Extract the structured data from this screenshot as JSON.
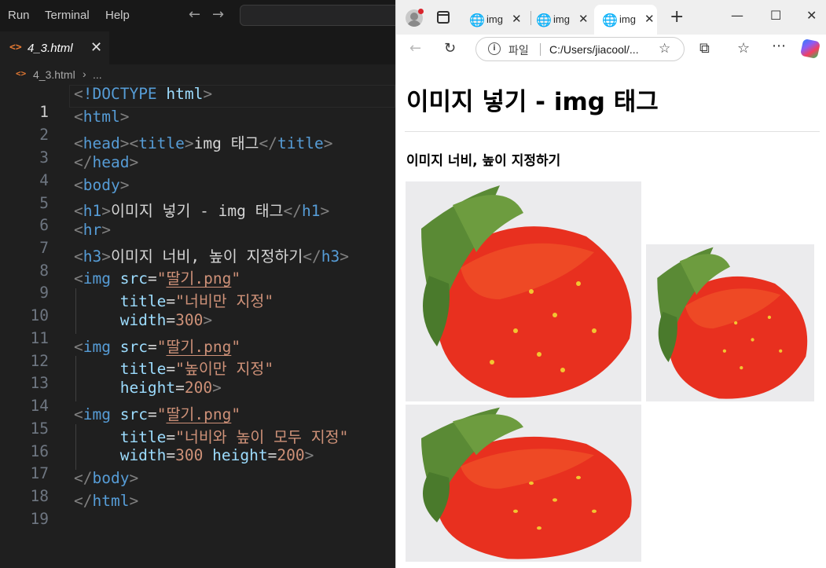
{
  "vscode": {
    "menu": [
      "Run",
      "Terminal",
      "Help"
    ],
    "tab": {
      "label": "4_3.html",
      "close": "✕"
    },
    "breadcrumb": {
      "file": "4_3.html",
      "separator": "›",
      "more": "..."
    },
    "line_numbers": [
      "1",
      "2",
      "3",
      "4",
      "5",
      "6",
      "7",
      "8",
      "9",
      "10",
      "11",
      "12",
      "13",
      "14",
      "15",
      "16",
      "17",
      "18",
      "19"
    ],
    "code": {
      "l1": {
        "doctype": "!DOCTYPE",
        "html": "html"
      },
      "l2": {
        "tag": "html"
      },
      "l3": {
        "head": "head",
        "title": "title",
        "text": "img 태그",
        "title_close": "title"
      },
      "l4": {
        "tag": "head"
      },
      "l5": {
        "tag": "body"
      },
      "l6": {
        "tag": "h1",
        "text": "이미지 넣기 - img 태그",
        "close": "h1"
      },
      "l7": {
        "tag": "hr"
      },
      "l8": {
        "tag": "h3",
        "text": "이미지 너비, 높이 지정하기",
        "close": "h3"
      },
      "l9": {
        "tag": "img",
        "attr": "src",
        "value": "딸기.png"
      },
      "l10": {
        "attr": "title",
        "value": "너비만 지정"
      },
      "l11": {
        "attr": "width",
        "value": "300"
      },
      "l12": {
        "tag": "img",
        "attr": "src",
        "value": "딸기.png"
      },
      "l13": {
        "attr": "title",
        "value": "높이만 지정"
      },
      "l14": {
        "attr": "height",
        "value": "200"
      },
      "l15": {
        "tag": "img",
        "attr": "src",
        "value": "딸기.png"
      },
      "l16": {
        "attr": "title",
        "value": "너비와 높이 모두 지정"
      },
      "l17": {
        "attr1": "width",
        "value1": "300",
        "attr2": "height",
        "value2": "200"
      },
      "l18": {
        "tag": "body"
      },
      "l19": {
        "tag": "html"
      }
    }
  },
  "browser": {
    "tabs": [
      {
        "label": "img"
      },
      {
        "label": "img"
      },
      {
        "label": "img"
      }
    ],
    "address": {
      "scheme_label": "파일",
      "url": "C:/Users/jiacool/..."
    },
    "page": {
      "h1": "이미지 넣기 - img 태그",
      "h3": "이미지 너비, 높이 지정하기",
      "images": [
        {
          "title": "너비만 지정"
        },
        {
          "title": "높이만 지정"
        },
        {
          "title": "너비와 높이 모두 지정"
        }
      ]
    }
  },
  "icons": [
    "back-arrow-icon",
    "forward-arrow-icon",
    "file-html-icon",
    "profile-icon",
    "tab-actions-icon",
    "globe-icon",
    "close-icon",
    "new-tab-icon",
    "minimize-icon",
    "maximize-icon",
    "refresh-icon",
    "info-icon",
    "favorite-star-icon",
    "extensions-icon",
    "favorites-icon",
    "more-icon",
    "copilot-icon"
  ]
}
